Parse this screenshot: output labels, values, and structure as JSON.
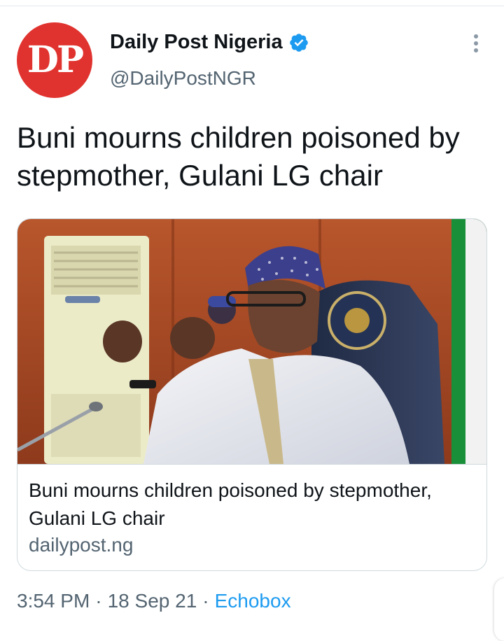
{
  "author": {
    "avatar_text": "DP",
    "name": "Daily Post Nigeria",
    "handle": "@DailyPostNGR",
    "verified": true
  },
  "tweet": {
    "text": "Buni mourns children poisoned by stepmother, Gulani LG chair"
  },
  "card": {
    "title": "Buni mourns children poisoned by stepmother, Gulani LG chair",
    "domain": "dailypost.ng"
  },
  "meta": {
    "time": "3:54 PM",
    "separator": "·",
    "date": "18 Sep 21",
    "source": "Echobox"
  },
  "icons": {
    "verified": "verified-badge-icon",
    "more": "more-vertical-icon"
  },
  "colors": {
    "avatar_bg": "#e0332f",
    "verified": "#1d9bf0",
    "link": "#1d9bf0",
    "secondary_text": "#536471"
  }
}
